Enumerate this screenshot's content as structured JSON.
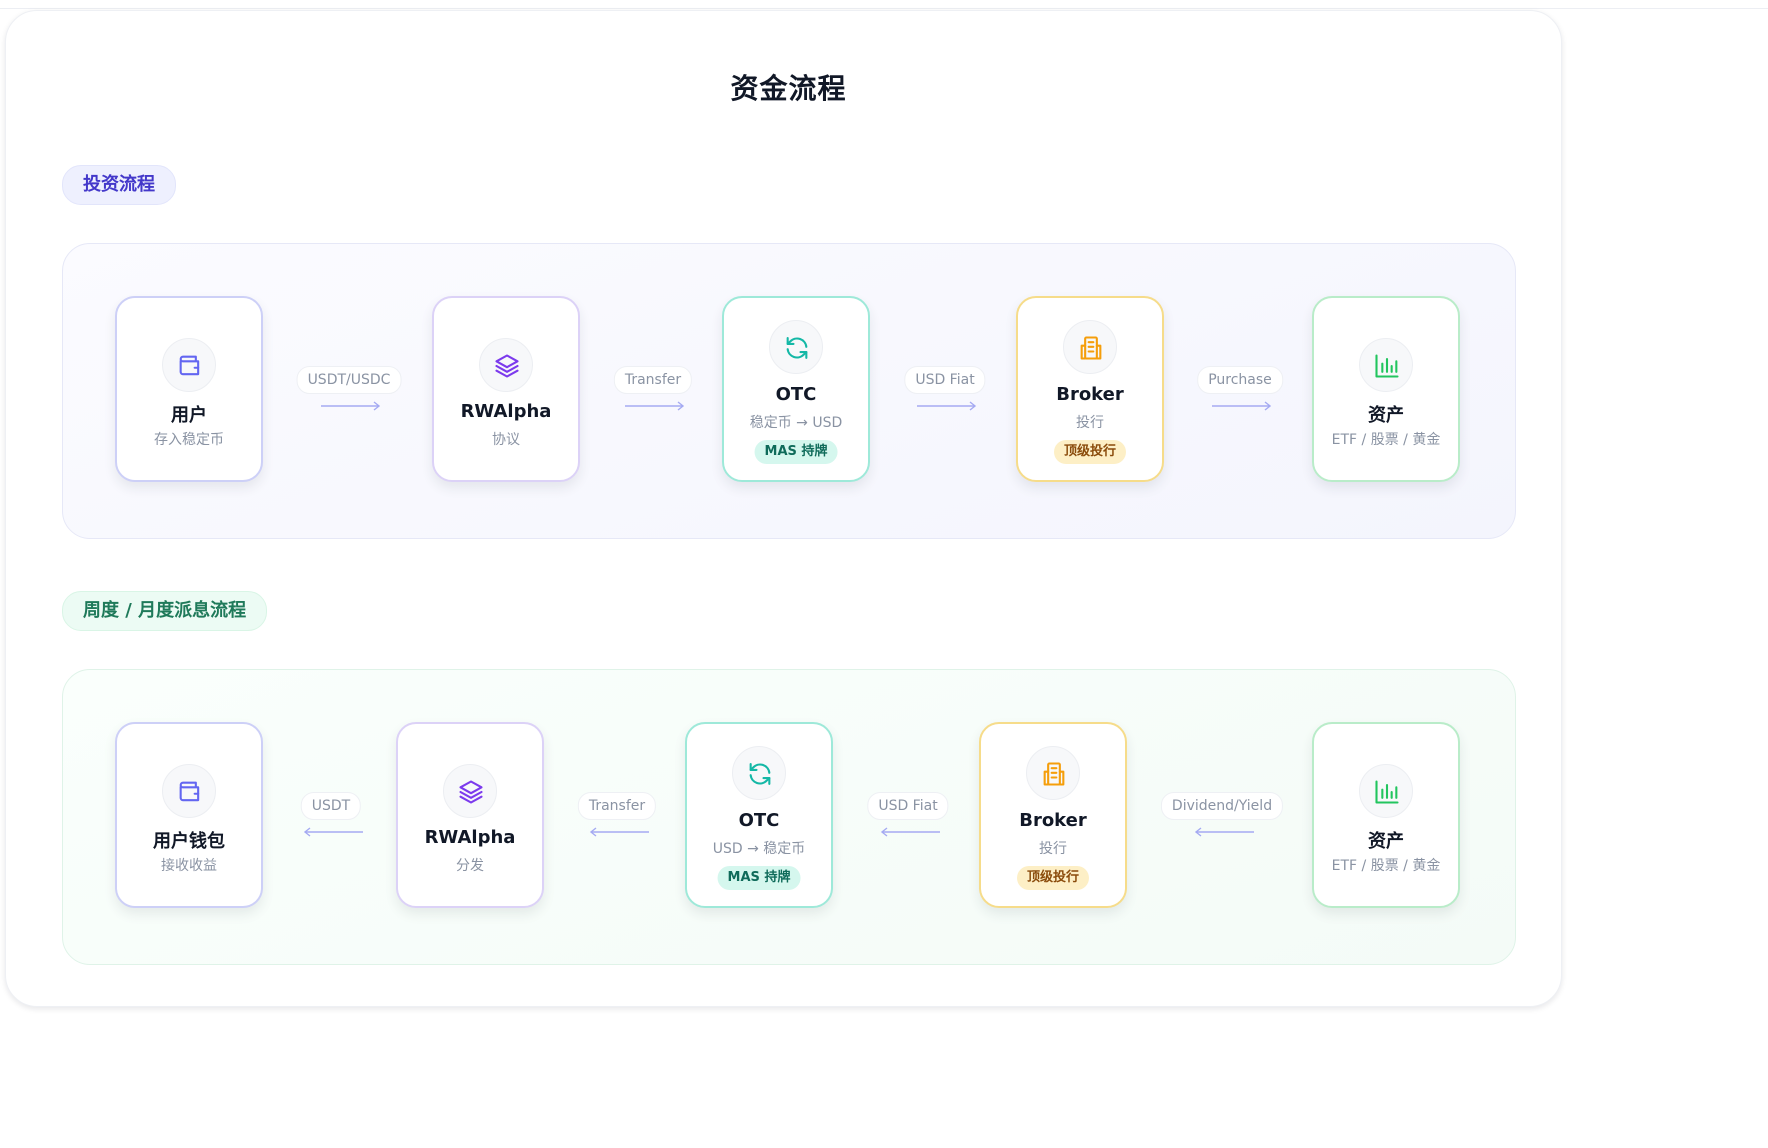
{
  "title": "资金流程",
  "colors": {
    "indigo": "#6366f1",
    "purple": "#7c3aed",
    "teal": "#14b8a6",
    "amber": "#f59e0b",
    "green": "#22c55e",
    "muted": "#8a93a3"
  },
  "invest": {
    "heading": "投资流程",
    "nodes": [
      {
        "icon": "wallet-icon",
        "name": "用户",
        "sub": "存入稳定币"
      },
      {
        "icon": "layers-icon",
        "name": "RWAlpha",
        "sub": "协议"
      },
      {
        "icon": "refresh-icon",
        "name": "OTC",
        "sub": "稳定币 → USD",
        "badge": "MAS 持牌"
      },
      {
        "icon": "building-icon",
        "name": "Broker",
        "sub": "投行",
        "badge": "顶级投行"
      },
      {
        "icon": "chart-icon",
        "name": "资产",
        "sub": "ETF / 股票 / 黄金"
      }
    ],
    "connectors": [
      {
        "label": "USDT/USDC",
        "direction": "right"
      },
      {
        "label": "Transfer",
        "direction": "right"
      },
      {
        "label": "USD Fiat",
        "direction": "right"
      },
      {
        "label": "Purchase",
        "direction": "right"
      }
    ]
  },
  "dividend": {
    "heading": "周度 / 月度派息流程",
    "nodes": [
      {
        "icon": "wallet-icon",
        "name": "用户钱包",
        "sub": "接收收益"
      },
      {
        "icon": "layers-icon",
        "name": "RWAlpha",
        "sub": "分发"
      },
      {
        "icon": "refresh-icon",
        "name": "OTC",
        "sub": "USD → 稳定币",
        "badge": "MAS 持牌"
      },
      {
        "icon": "building-icon",
        "name": "Broker",
        "sub": "投行",
        "badge": "顶级投行"
      },
      {
        "icon": "chart-icon",
        "name": "资产",
        "sub": "ETF / 股票 / 黄金"
      }
    ],
    "connectors": [
      {
        "label": "USDT",
        "direction": "left"
      },
      {
        "label": "Transfer",
        "direction": "left"
      },
      {
        "label": "USD Fiat",
        "direction": "left"
      },
      {
        "label": "Dividend/Yield",
        "direction": "left"
      }
    ]
  }
}
